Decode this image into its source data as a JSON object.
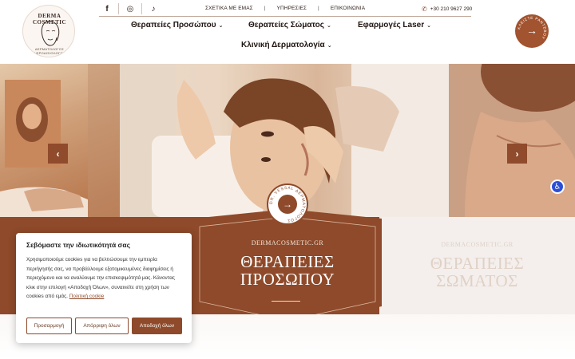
{
  "header": {
    "logo": {
      "name": "DERMA COSMETIC",
      "tagline": "ΔΕΡΜΑΤΟΛΟΓΟΣ ΑΦΡΟΔΙΣΙΟΛΟΓΟΣ"
    },
    "socials": [
      {
        "icon": "facebook-icon",
        "glyph": "f"
      },
      {
        "icon": "instagram-icon",
        "glyph": "◎"
      },
      {
        "icon": "tiktok-icon",
        "glyph": "♪"
      }
    ],
    "top_links": [
      "ΣΧΕΤΙΚΑ ΜΕ ΕΜΑΣ",
      "ΥΠΗΡΕΣΙΕΣ",
      "ΕΠΙΚΟΙΝΩΝΙΑ"
    ],
    "separator": "|",
    "phone": "+30 210 9627 290",
    "nav": [
      {
        "label": "Θεραπείες Προσώπου"
      },
      {
        "label": "Θεραπείες Σώματος"
      },
      {
        "label": "Εφαρμογές Laser"
      },
      {
        "label": "Κλινική Δερματολογία"
      }
    ],
    "cta_ring_text": "ΚΛΕΙΣΤΕ ΡΑΝΤΕΒΟΥ",
    "caret": "⌄"
  },
  "hero": {
    "prev_arrow": "‹",
    "next_arrow": "›",
    "badge_ring_text": "DR. VESSAL ΔΕΡΜΑΤΟΛΟΓΟΣ",
    "badge_arrow": "→"
  },
  "cards": {
    "active": {
      "site": "DERMACOSMETIC.GR",
      "title_line1": "ΘΕΡΑΠΕΙΕΣ",
      "title_line2": "ΠΡΟΣΩΠΟΥ"
    },
    "next": {
      "site": "DERMACOSMETIC.GR",
      "title_line1": "ΘΕΡΑΠΕΙΕΣ",
      "title_line2": "ΣΩΜΑΤΟΣ"
    }
  },
  "cookie": {
    "title": "Σεβόμαστε την ιδιωτικότητά σας",
    "body": "Χρησιμοποιούμε cookies για να βελτιώσουμε την εμπειρία περιήγησής σας, να προβάλλουμε εξατομικευμένες διαφημίσεις ή περιεχόμενο και να αναλύουμε την επισκεψιμότητά μας. Κάνοντας κλικ στην επιλογή «Αποδοχή Όλων», συναινείτε στη χρήση των cookies από εμάς.",
    "policy_link": "Πολιτική cookie",
    "buttons": {
      "customize": "Προσαρμογή",
      "reject": "Απόρριψη όλων",
      "accept": "Αποδοχή όλων"
    }
  },
  "colors": {
    "brand": "#8e4a2a",
    "cta": "#a2532f",
    "accessibility": "#2d4fd6"
  },
  "accessibility_icon": "accessibility-icon"
}
